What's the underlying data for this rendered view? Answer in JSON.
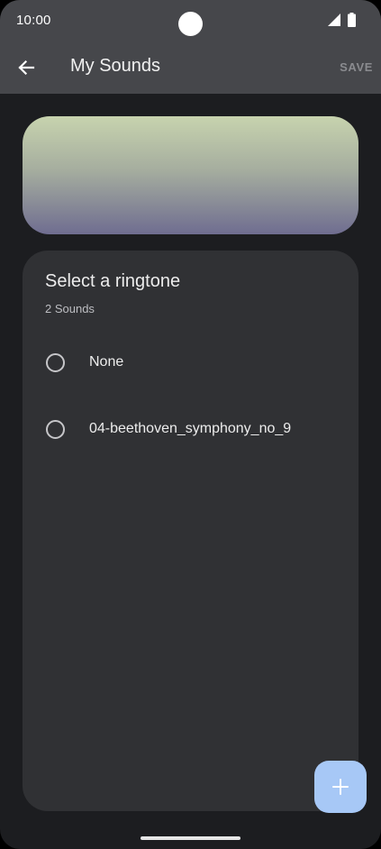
{
  "status_bar": {
    "time": "10:00",
    "signal_icon": "signal-icon",
    "battery_icon": "battery-icon"
  },
  "app_bar": {
    "back_icon": "arrow-back-icon",
    "title": "My Sounds",
    "save_label": "SAVE"
  },
  "card": {
    "title": "Select a ringtone",
    "subtitle": "2 Sounds",
    "options": [
      {
        "label": "None",
        "selected": false
      },
      {
        "label": "04-beethoven_symphony_no_9",
        "selected": false
      }
    ]
  },
  "fab": {
    "icon": "plus-icon"
  },
  "colors": {
    "app_bar": "#46474b",
    "background": "#1c1d20",
    "card": "#303134",
    "fab": "#a7c8f6",
    "preview_top": "#c7d3ae",
    "preview_bottom": "#6f6d90"
  }
}
